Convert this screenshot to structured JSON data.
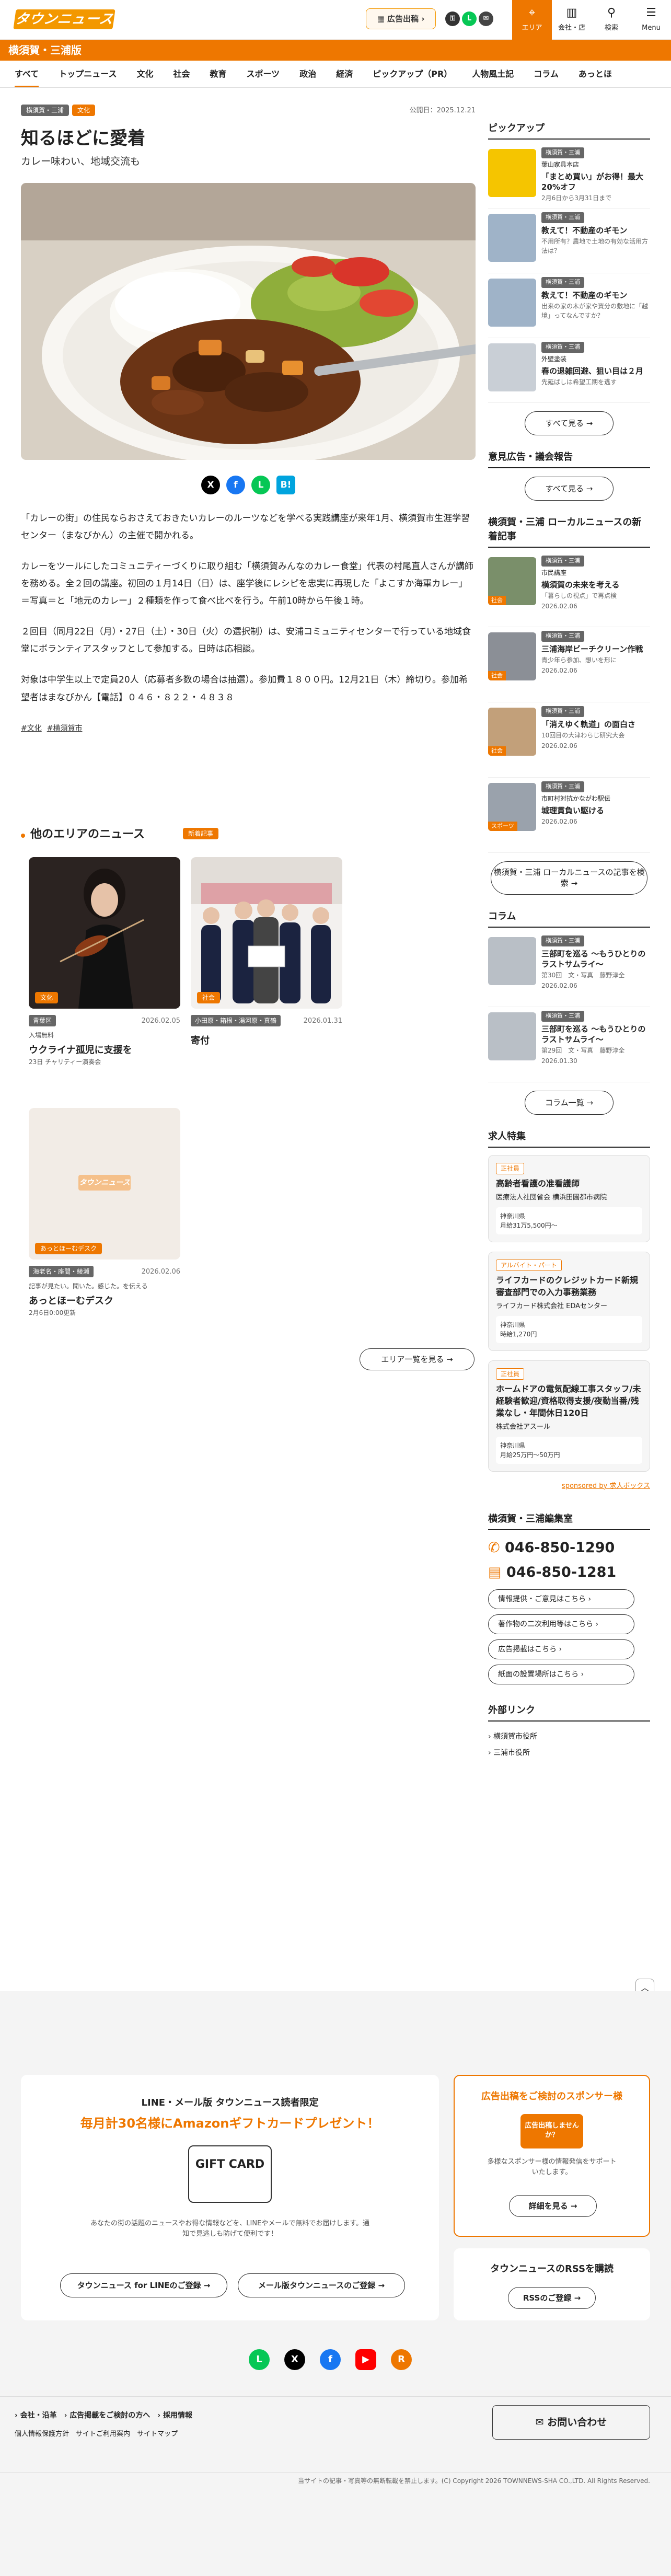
{
  "header": {
    "logo": "タウンニュース",
    "ad_button": "広告出稿",
    "share_icons": [
      "LINE",
      "SNS"
    ],
    "nav": [
      {
        "label": "エリア",
        "icon": "location-pin-icon"
      },
      {
        "label": "会社・店",
        "icon": "building-icon"
      },
      {
        "label": "検索",
        "icon": "search-icon"
      },
      {
        "label": "Menu",
        "icon": "menu-icon"
      }
    ]
  },
  "area_title": "横須賀・三浦版",
  "tabs": [
    "すべて",
    "トップニュース",
    "文化",
    "社会",
    "教育",
    "スポーツ",
    "政治",
    "経済",
    "ピックアップ（PR）",
    "人物風土記",
    "コラム",
    "あっとほ"
  ],
  "article": {
    "tags": [
      "横須賀・三浦",
      "文化"
    ],
    "published": "公開日：2025.12.21",
    "title": "知るほどに愛着",
    "subtitle": "カレー味わい、地域交流も",
    "paragraphs": [
      "「カレーの街」の住民ならおさえておきたいカレーのルーツなどを学べる実践講座が来年1月、横須賀市生涯学習センター（まなびかん）の主催で開かれる。",
      "カレーをツールにしたコミュニティーづくりに取り組む「横須賀みんなのカレー食堂」代表の村尾直人さんが講師を務める。全２回の講座。初回の１月14日（日）は、座学後にレシピを忠実に再現した「よこすか海軍カレー」＝写真＝と「地元のカレー」２種類を作って食べ比べを行う。午前10時から午後１時。",
      "２回目（同月22日（月）・27日（土）・30日（火）の選択制）は、安浦コミュニティセンターで行っている地域食堂にボランティアスタッフとして参加する。日時は応相談。",
      "対象は中学生以上で定員20人（応募者多数の場合は抽選）。参加費１８００円。12月21日（木）締切り。参加希望者はまなびかん【電話】０４６・８２２・４８３８"
    ],
    "hashtags": [
      "#文化",
      "#横須賀市"
    ]
  },
  "share": [
    "X",
    "f",
    "L",
    "B!"
  ],
  "other_area": {
    "title": "他のエリアのニュース",
    "badge": "新着記事",
    "cards": [
      {
        "category": "文化",
        "area": "青葉区",
        "date": "2026.02.05",
        "kicker": "入場無料",
        "title": "ウクライナ孤児に支援を",
        "note": "23日 チャリティー演奏会"
      },
      {
        "category": "社会",
        "area": "小田原・箱根・湯河原・真鶴",
        "date": "2026.01.31",
        "kicker": "",
        "title": "寄付",
        "note": ""
      },
      {
        "category": "あっとほーむデスク",
        "area": "海老名・座間・綾瀬",
        "date": "2026.02.06",
        "kicker": "",
        "title": "あっとほーむデスク",
        "note": "2月6日0:00更新",
        "desc": "記事が見たい。聞いた。感じた。を伝える"
      }
    ],
    "more": "エリア一覧を見る"
  },
  "sidebar": {
    "pickup_title": "ピックアップ",
    "pickup": [
      {
        "tag": "横須賀・三浦",
        "kicker": "葉山家具本店",
        "title": "「まとめ買い」がお得！最大20%オフ",
        "desc": "2月6日から3月31日まで"
      },
      {
        "tag": "横須賀・三浦",
        "kicker": "",
        "title": "教えて！不動産のギモン",
        "desc": "不用所有？農地で土地の有効な活用方法は？"
      },
      {
        "tag": "横須賀・三浦",
        "kicker": "",
        "title": "教えて！不動産のギモン",
        "desc": "出来の家の木が家や資分の敷地に「越境」ってなんですか？"
      },
      {
        "tag": "横須賀・三浦",
        "kicker": "外壁塗装",
        "title": "春の退雑回避、狙い目は２月",
        "desc": "先延ばしは希望工期を逃す"
      }
    ],
    "pickup_more": "すべて見る",
    "notice_title": "意見広告・議会報告",
    "notice_more": "すべて見る",
    "local_title": "横須賀・三浦 ローカルニュースの新着記事",
    "local": [
      {
        "tag": "横須賀・三浦",
        "kicker": "市民講座",
        "title": "横須賀の未来を考える",
        "desc": "「暮らしの視点」で再点検",
        "date": "2026.02.06",
        "cat": "社会"
      },
      {
        "tag": "横須賀・三浦",
        "kicker": "",
        "title": "三浦海岸ビーチクリーン作戦",
        "desc": "青少年ら参加、想いを形に",
        "date": "2026.02.06",
        "cat": "社会"
      },
      {
        "tag": "横須賀・三浦",
        "kicker": "",
        "title": "「消えゆく軌道」の面白さ",
        "desc": "10回目の大津わらじ研究大会",
        "date": "2026.02.06",
        "cat": "社会"
      },
      {
        "tag": "横須賀・三浦",
        "kicker": "市町村対抗かながわ駅伝",
        "title": "城理貫負い駆ける",
        "desc": "",
        "date": "2026.02.06",
        "cat": "スポーツ"
      }
    ],
    "local_more": "横須賀・三浦 ローカルニュースの記事を検索",
    "column_title": "コラム",
    "columns": [
      {
        "tag": "横須賀・三浦",
        "title": "三部町を巡る 〜もうひとりのラストサムライ〜",
        "desc": "第30回　文・写真　藤野淳全",
        "date": "2026.02.06"
      },
      {
        "tag": "横須賀・三浦",
        "title": "三部町を巡る 〜もうひとりのラストサムライ〜",
        "desc": "第29回　文・写真　藤野淳全",
        "date": "2026.01.30"
      }
    ],
    "column_more": "コラム一覧",
    "jobs_title": "求人特集",
    "jobs": [
      {
        "type": "正社員",
        "title": "高齢者看護の准看護師",
        "company": "医療法人社団省会 横浜田園都市病院",
        "place": "神奈川県",
        "pay": "月給31万5,500円〜"
      },
      {
        "type": "アルバイト・パート",
        "title": "ライフカードのクレジットカード新規審査部門での入力事務業務",
        "company": "ライフカード株式会社 EDAセンター",
        "place": "神奈川県",
        "pay": "時給1,270円"
      },
      {
        "type": "正社員",
        "title": "ホームドアの電気配線工事スタッフ/未経験者歓迎/資格取得支援/夜勤当番/残業なし・年間休日120日",
        "company": "株式会社アスール",
        "place": "神奈川県",
        "pay": "月給25万円〜50万円"
      }
    ],
    "jobs_sponsor": "sponsored by 求人ボックス",
    "office_title": "横須賀・三浦編集室",
    "phone": "046-850-1290",
    "fax": "046-850-1281",
    "office_links": [
      "情報提供・ご意見はこちら",
      "著作物の二次利用等はこちら",
      "広告掲載はこちら",
      "紙面の設置場所はこちら"
    ],
    "ext_title": "外部リンク",
    "ext_links": [
      "横須賀市役所",
      "三浦市役所"
    ]
  },
  "footer": {
    "campaign_head": "LINE・メール版 タウンニュース読者限定",
    "campaign_title": "毎月計30名様にAmazonギフトカードプレゼント！",
    "gift_label": "GIFT CARD",
    "campaign_note": "あなたの街の話題のニュースやお得な情報などを、LINEやメールで無料でお届けします。通知で見逃しも防げて便利です！",
    "line_button": "タウンニュース for LINEのご登録",
    "mail_button": "メール版タウンニュースのご登録",
    "sponsor_title": "広告出稿をご検討のスポンサー様",
    "sponsor_badge": "広告出稿しませんか？",
    "sponsor_note": "多様なスポンサー様の情報発信をサポートいたします。",
    "sponsor_button": "詳細を見る",
    "rss_title": "タウンニュースのRSSを購読",
    "rss_button": "RSSのご登録",
    "links_row1": [
      "会社・沿革",
      "広告掲載をご検討の方へ",
      "採用情報"
    ],
    "links_row2": [
      "個人情報保護方針",
      "サイトご利用案内",
      "サイトマップ"
    ],
    "contact": "お問い合わせ",
    "copyright": "当サイトの記事・写真等の無断転載を禁止します。(C) Copyright 2026 TOWNNEWS-SHA CO.,LTD. All Rights Reserved.",
    "social": [
      "L",
      "X",
      "f",
      "▶",
      "R"
    ]
  },
  "colors": {
    "accent": "#ee7700",
    "line": "#06c755",
    "facebook": "#1877f2",
    "youtube": "#ff0000",
    "hatena": "#00a4de"
  }
}
